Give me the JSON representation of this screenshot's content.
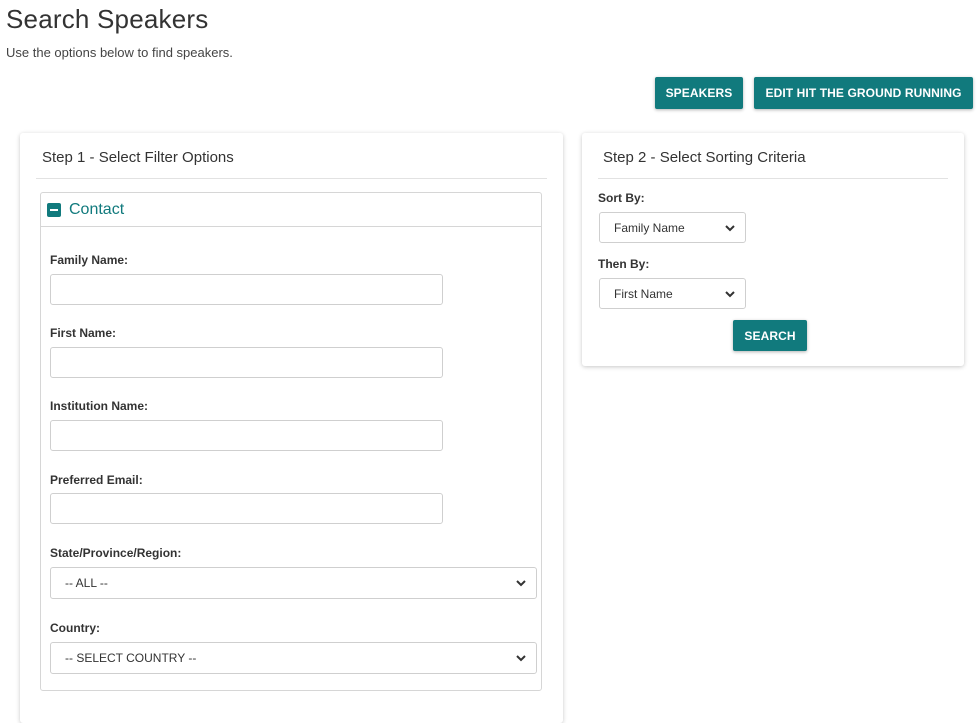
{
  "header": {
    "title": "Search Speakers",
    "subtitle": "Use the options below to find speakers."
  },
  "toolbar": {
    "speakers_label": "SPEAKERS",
    "edit_label": "EDIT HIT THE GROUND RUNNING"
  },
  "step1": {
    "title": "Step 1 - Select Filter Options",
    "contact_panel": {
      "title": "Contact",
      "fields": {
        "family_name": {
          "label": "Family Name:",
          "value": ""
        },
        "first_name": {
          "label": "First Name:",
          "value": ""
        },
        "institution_name": {
          "label": "Institution Name:",
          "value": ""
        },
        "preferred_email": {
          "label": "Preferred Email:",
          "value": ""
        },
        "state": {
          "label": "State/Province/Region:",
          "value": "-- ALL --"
        },
        "country": {
          "label": "Country:",
          "value": "-- SELECT COUNTRY --"
        }
      }
    }
  },
  "step2": {
    "title": "Step 2 - Select Sorting Criteria",
    "sort_by": {
      "label": "Sort By:",
      "value": "Family Name"
    },
    "then_by": {
      "label": "Then By:",
      "value": "First Name"
    },
    "search_label": "SEARCH"
  },
  "colors": {
    "accent": "#117a7d"
  }
}
